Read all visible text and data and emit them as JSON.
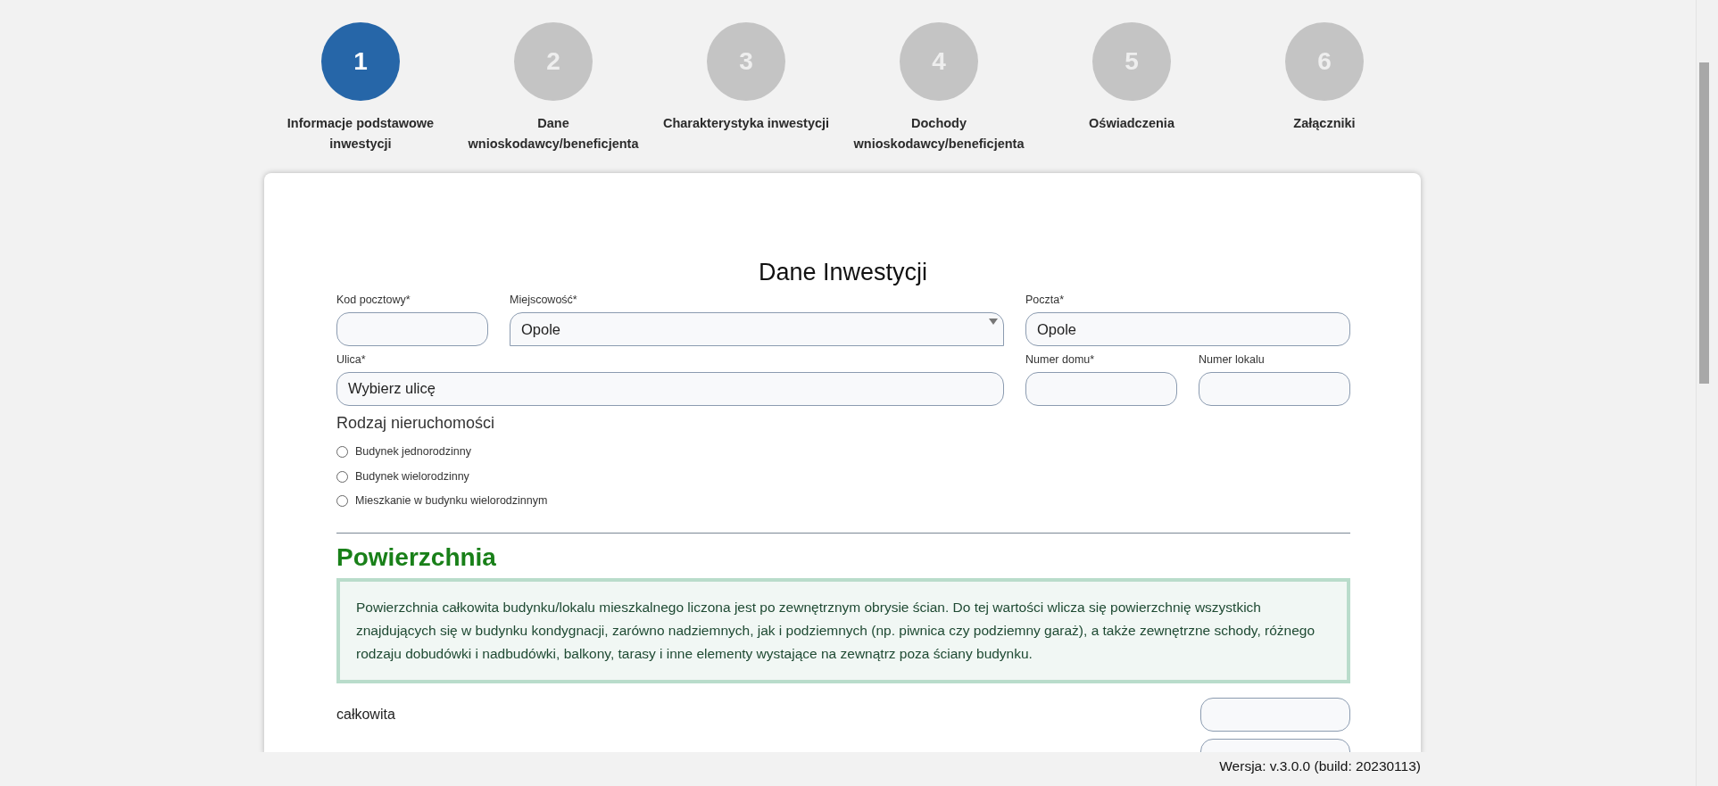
{
  "steps": [
    {
      "number": "1",
      "label": "Informacje podstawowe inwestycji",
      "selected": true
    },
    {
      "number": "2",
      "label": "Dane wnioskodawcy/beneficjenta",
      "selected": false
    },
    {
      "number": "3",
      "label": "Charakterystyka inwestycji",
      "selected": false
    },
    {
      "number": "4",
      "label": "Dochody wnioskodawcy/beneficjenta",
      "selected": false
    },
    {
      "number": "5",
      "label": "Oświadczenia",
      "selected": false
    },
    {
      "number": "6",
      "label": "Załączniki",
      "selected": false
    }
  ],
  "form": {
    "title": "Dane Inwestycji",
    "fields": [
      {
        "kind": "input",
        "label": "Kod pocztowy*"
      },
      {
        "kind": "select",
        "label": "Miejscowość*",
        "value": "Opole"
      },
      {
        "kind": "input",
        "label": "Poczta*",
        "value": "Opole"
      },
      {
        "kind": "input",
        "label": "Ulica*",
        "value": "Wybierz ulicę"
      },
      {
        "kind": "input",
        "label": "Numer domu*"
      },
      {
        "kind": "input",
        "label": "Numer lokalu"
      }
    ],
    "property_type": {
      "title": "Rodzaj nieruchomości",
      "options": [
        {
          "label": "Budynek jednorodzinny",
          "selected": false
        },
        {
          "label": "Budynek wielorodzinny",
          "selected": false
        },
        {
          "label": "Mieszkanie w budynku wielorodzinnym",
          "selected": false
        }
      ]
    }
  },
  "area": {
    "title": "Powierzchnia",
    "info": "Powierzchnia całkowita budynku/lokalu mieszkalnego liczona jest po zewnętrznym obrysie ścian. Do tej wartości wlicza się powierzchnię wszystkich znajdujących się w budynku kondygnacji, zarówno nadziemnych, jak i podziemnych (np. piwnica czy podziemny garaż), a także zewnętrzne schody, różnego rodzaju dobudówki i nadbudówki, balkony, tarasy i inne elementy wystające na zewnątrz poza ściany budynku.",
    "rows": [
      {
        "kind": "labeled",
        "label": "całkowita"
      },
      {
        "kind": "unlabeled"
      }
    ]
  },
  "footer": {
    "version": "Wersja: v.3.0.0 (build: 20230113)"
  }
}
